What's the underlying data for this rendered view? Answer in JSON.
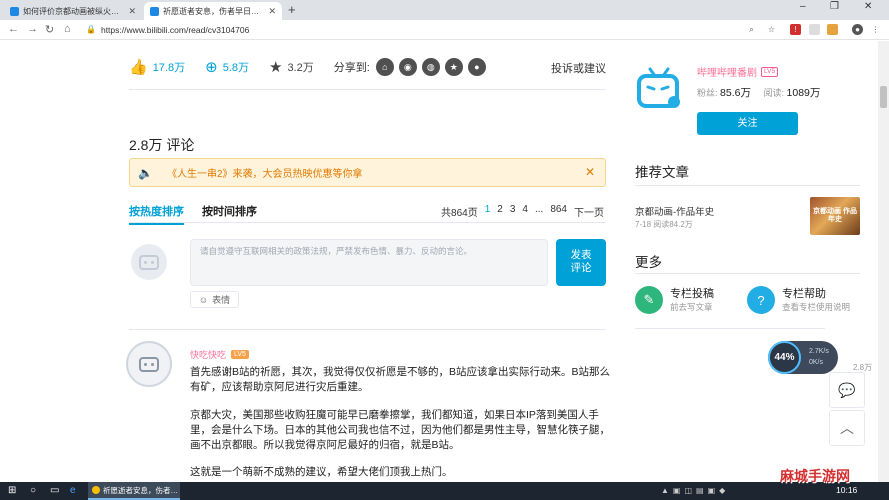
{
  "browser": {
    "tabs": [
      {
        "title": "如何评价京都动画被纵火后B站出…",
        "active": false
      },
      {
        "title": "祈愿逝者安息，伤者早日康复 - 哔…",
        "active": true
      }
    ],
    "new_tab": "+",
    "controls": {
      "minimize": "–",
      "maximize": "❐",
      "close": "✕"
    },
    "url": "https://www.bilibili.com/read/cv3104706"
  },
  "article": {
    "likes": "17.8万",
    "coins": "5.8万",
    "favorites": "3.2万",
    "share_label": "分享到:",
    "complaint": "投诉或建议"
  },
  "comments": {
    "count_label": "2.8万 评论",
    "notice": "《人生一串2》来袭，大会员热映优惠等你拿",
    "sort_hot": "按热度排序",
    "sort_time": "按时间排序",
    "pager": {
      "total": "共864页",
      "pages": [
        "1",
        "2",
        "3",
        "4",
        "...",
        "864"
      ],
      "next": "下一页"
    },
    "input_placeholder": "请自觉遵守互联网相关的政策法规，严禁发布色情、暴力、反动的言论。",
    "send_label_1": "发表",
    "send_label_2": "评论",
    "emoji_label": "表情",
    "first": {
      "user": "快吃快吃",
      "level": "LV5",
      "paragraphs": [
        "首先感谢B站的祈愿，其次，我觉得仅仅祈愿是不够的，B站应该拿出实际行动来。B站那么有矿，应该帮助京阿尼进行灾后重建。",
        "京都大灾，美国那些收购狂魔可能早已磨拳擦掌，我们都知道，如果日本IP落到美国人手里，会是什么下场。日本的其他公司我也信不过，因为他们都是男性主导，智慧化筷子腿，画不出京都眼。所以我觉得京阿尼最好的归宿，就是B站。",
        "这就是一个萌新不成熟的建议，希望大佬们顶我上热门。"
      ]
    }
  },
  "sidebar": {
    "up_name": "哔哩哔哩番剧",
    "up_level": "LV5",
    "fans_label": "粉丝:",
    "fans": "85.6万",
    "reads_label": "阅读:",
    "reads": "1089万",
    "follow": "关注",
    "recommend_title": "推荐文章",
    "rec_article": {
      "title": "京都动画-作品年史",
      "meta": "7-18 阅读84.2万",
      "thumb_text": "京都动画 作品年史"
    },
    "more_title": "更多",
    "more": [
      {
        "title": "专栏投稿",
        "sub": "前去写文章",
        "color": "#2fb67c"
      },
      {
        "title": "专栏帮助",
        "sub": "查看专栏使用说明",
        "color": "#23ade5"
      }
    ]
  },
  "floating": {
    "speed_pct": "44%",
    "speed_up": "2.7K/s",
    "speed_down": "0K/s",
    "comment_count": "2.8万"
  },
  "taskbar": {
    "task_label": "祈愿逝者安息，伤者…",
    "watermark": "麻城手游网",
    "time": "10:16"
  },
  "colors": {
    "accent": "#00a1d6",
    "pink": "#fb7299",
    "notice_bg": "#fff3dc",
    "notice_text": "#e07b00"
  }
}
